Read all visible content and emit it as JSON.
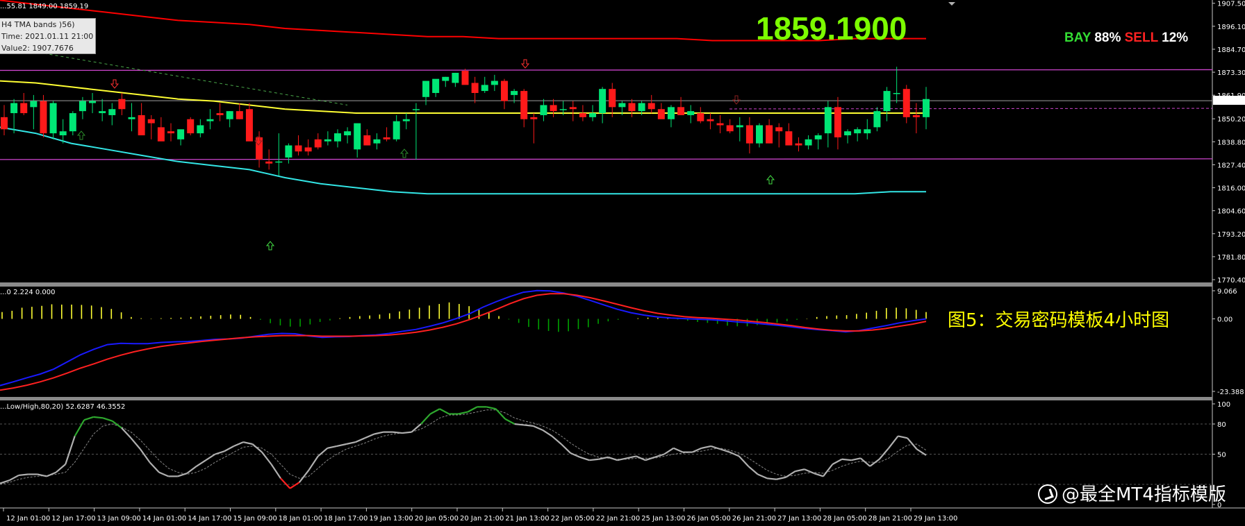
{
  "header": {
    "pane_title": "...55.81 1849.00 1859.19",
    "tooltip": {
      "line1": "H4 TMA bands )56)",
      "line2": "Time: 2021.01.11 21:00",
      "line3": "Value2: 1907.7676"
    },
    "big_price": "1859.1900",
    "sentiment": {
      "bay_label": "BAY",
      "bay_pct": "88%",
      "sell_label": "SELL",
      "sell_pct": "12%"
    }
  },
  "caption": "图5：交易密码模板4小时图",
  "watermark": "@最全MT4指标模版",
  "colors": {
    "bull": "#00e676",
    "bear": "#ff1a1a",
    "upper_band": "#ff0000",
    "mid_band": "#ffff33",
    "lower_band": "#33e6e6",
    "magenta": "#cc44cc",
    "macd_fast": "#1a1aff",
    "macd_slow": "#ff2020",
    "hist_pos": "#ffff33",
    "hist_neg": "#00a000",
    "stoch_main": "#b0b0b0",
    "stoch_ob": "#2ea82e",
    "stoch_os": "#ff2020"
  },
  "chart_data": [
    {
      "type": "candlestick",
      "title": "",
      "ylim": [
        1770.4,
        1907.75
      ],
      "y_ticks": [
        "1907.50",
        "1896.10",
        "1884.70",
        "1873.30",
        "1861.90",
        "1850.20",
        "1838.80",
        "1827.40",
        "1816.00",
        "1804.60",
        "1793.20",
        "1781.80",
        "1770.40"
      ],
      "current_price": "1859.19",
      "x_labels": [
        "12 Jan 01:00",
        "12 Jan 17:00",
        "13 Jan 09:00",
        "14 Jan 01:00",
        "14 Jan 17:00",
        "15 Jan 09:00",
        "18 Jan 01:00",
        "18 Jan 17:00",
        "19 Jan 13:00",
        "20 Jan 05:00",
        "20 Jan 21:00",
        "21 Jan 13:00",
        "22 Jan 05:00",
        "22 Jan 21:00",
        "25 Jan 13:00",
        "26 Jan 05:00",
        "26 Jan 21:00",
        "27 Jan 13:00",
        "28 Jan 05:00",
        "28 Jan 21:00",
        "29 Jan 13:00"
      ],
      "ohlc": [
        [
          1851,
          1857,
          1842,
          1845
        ],
        [
          1853,
          1860,
          1843,
          1858
        ],
        [
          1858,
          1863,
          1852,
          1853
        ],
        [
          1856,
          1862,
          1845,
          1859
        ],
        [
          1859,
          1862,
          1841,
          1843
        ],
        [
          1843,
          1859,
          1840,
          1858
        ],
        [
          1842,
          1850,
          1838,
          1844
        ],
        [
          1844,
          1854,
          1842,
          1853
        ],
        [
          1854,
          1861,
          1850,
          1859
        ],
        [
          1858,
          1863,
          1853,
          1859
        ],
        [
          1853,
          1860,
          1849,
          1854
        ],
        [
          1852,
          1858,
          1847,
          1855
        ],
        [
          1860,
          1863,
          1852,
          1855
        ],
        [
          1850,
          1858,
          1844,
          1851
        ],
        [
          1852,
          1858,
          1844,
          1842
        ],
        [
          1850,
          1852,
          1840,
          1848
        ],
        [
          1846,
          1851,
          1843,
          1839
        ],
        [
          1844,
          1848,
          1839,
          1843
        ],
        [
          1840,
          1843,
          1837,
          1845
        ],
        [
          1850,
          1851,
          1842,
          1843
        ],
        [
          1843,
          1850,
          1841,
          1847
        ],
        [
          1849,
          1855,
          1845,
          1850
        ],
        [
          1853,
          1858,
          1849,
          1852
        ],
        [
          1850,
          1854,
          1846,
          1854
        ],
        [
          1854,
          1858,
          1850,
          1850
        ],
        [
          1855,
          1858,
          1842,
          1839
        ],
        [
          1841,
          1844,
          1826,
          1830
        ],
        [
          1829,
          1835,
          1825,
          1828
        ],
        [
          1829,
          1843,
          1822,
          1829
        ],
        [
          1831,
          1838,
          1828,
          1837
        ],
        [
          1837,
          1842,
          1832,
          1834
        ],
        [
          1836,
          1840,
          1832,
          1834
        ],
        [
          1840,
          1843,
          1835,
          1836
        ],
        [
          1839,
          1844,
          1837,
          1840
        ],
        [
          1839,
          1845,
          1836,
          1843
        ],
        [
          1842,
          1846,
          1838,
          1844
        ],
        [
          1835,
          1842,
          1831,
          1848
        ],
        [
          1842,
          1845,
          1837,
          1837
        ],
        [
          1838,
          1843,
          1835,
          1840
        ],
        [
          1841,
          1846,
          1839,
          1840
        ],
        [
          1840,
          1852,
          1839,
          1849
        ],
        [
          1849,
          1853,
          1845,
          1850
        ],
        [
          1855,
          1858,
          1830,
          1855
        ],
        [
          1861,
          1862,
          1857,
          1869
        ],
        [
          1863,
          1869,
          1861,
          1870
        ],
        [
          1869,
          1871,
          1866,
          1871
        ],
        [
          1868,
          1873,
          1866,
          1873
        ],
        [
          1874,
          1875,
          1868,
          1867
        ],
        [
          1868,
          1871,
          1858,
          1863
        ],
        [
          1864,
          1871,
          1863,
          1867
        ],
        [
          1867,
          1872,
          1864,
          1869
        ],
        [
          1869,
          1870,
          1855,
          1859
        ],
        [
          1862,
          1865,
          1858,
          1864
        ],
        [
          1864,
          1865,
          1846,
          1850
        ],
        [
          1851,
          1853,
          1838,
          1850
        ],
        [
          1852,
          1860,
          1849,
          1857
        ],
        [
          1857,
          1860,
          1851,
          1854
        ],
        [
          1855,
          1859,
          1852,
          1855
        ],
        [
          1856,
          1859,
          1849,
          1855
        ],
        [
          1853,
          1857,
          1849,
          1851
        ],
        [
          1851,
          1857,
          1849,
          1853
        ],
        [
          1853,
          1866,
          1848,
          1865
        ],
        [
          1865,
          1868,
          1851,
          1856
        ],
        [
          1856,
          1859,
          1852,
          1858
        ],
        [
          1858,
          1860,
          1851,
          1854
        ],
        [
          1854,
          1859,
          1852,
          1858
        ],
        [
          1858,
          1862,
          1853,
          1855
        ],
        [
          1855,
          1858,
          1851,
          1850
        ],
        [
          1850,
          1857,
          1846,
          1856
        ],
        [
          1856,
          1861,
          1852,
          1852
        ],
        [
          1852,
          1857,
          1848,
          1854
        ],
        [
          1853,
          1856,
          1848,
          1849
        ],
        [
          1850,
          1853,
          1845,
          1849
        ],
        [
          1848,
          1852,
          1843,
          1847
        ],
        [
          1847,
          1850,
          1843,
          1844
        ],
        [
          1846,
          1851,
          1839,
          1847
        ],
        [
          1847,
          1851,
          1833,
          1838
        ],
        [
          1838,
          1848,
          1836,
          1847
        ],
        [
          1847,
          1850,
          1838,
          1838
        ],
        [
          1846,
          1848,
          1836,
          1844
        ],
        [
          1844,
          1848,
          1838,
          1837
        ],
        [
          1838,
          1841,
          1834,
          1837
        ],
        [
          1837,
          1842,
          1835,
          1840
        ],
        [
          1840,
          1843,
          1835,
          1842
        ],
        [
          1843,
          1859,
          1836,
          1856
        ],
        [
          1856,
          1861,
          1835,
          1841
        ],
        [
          1842,
          1845,
          1838,
          1844
        ],
        [
          1843,
          1846,
          1839,
          1845
        ],
        [
          1843,
          1850,
          1840,
          1845
        ],
        [
          1846,
          1856,
          1844,
          1854
        ],
        [
          1854,
          1866,
          1849,
          1864
        ],
        [
          1863,
          1876,
          1858,
          1863
        ],
        [
          1865,
          1867,
          1848,
          1851
        ],
        [
          1852,
          1858,
          1843,
          1851
        ],
        [
          1851,
          1866,
          1845,
          1860
        ]
      ],
      "upper_band": [
        1909,
        1907,
        1905,
        1903,
        1901,
        1899,
        1898,
        1897,
        1895,
        1894,
        1893,
        1892,
        1891,
        1891,
        1890,
        1890,
        1890,
        1890,
        1890,
        1890,
        1889,
        1889,
        1889,
        1889,
        1890,
        1890,
        1890
      ],
      "mid_band": [
        1869,
        1868,
        1866,
        1864,
        1862,
        1860,
        1859,
        1857,
        1855,
        1854,
        1853,
        1853,
        1853,
        1853,
        1853,
        1853,
        1853,
        1853,
        1853,
        1853,
        1853,
        1853,
        1853,
        1853,
        1853,
        1853,
        1853
      ],
      "lower_band": [
        1846,
        1843,
        1838,
        1835,
        1832,
        1829,
        1827,
        1825,
        1821,
        1818,
        1816,
        1814,
        1813,
        1813,
        1813,
        1813,
        1813,
        1813,
        1813,
        1813,
        1813,
        1813,
        1813,
        1813,
        1813,
        1814,
        1814
      ],
      "magenta_upper": 1874.2,
      "magenta_lower": 1830.0
    },
    {
      "type": "line",
      "title": "",
      "header_text": "...0 2.224 0.000",
      "ylim": [
        -23.388,
        9.066
      ],
      "y_ticks": [
        "9.066",
        "0.00",
        "-23.388"
      ],
      "histogram": [
        2.2,
        2.6,
        3.6,
        3.9,
        4.2,
        4.7,
        4.6,
        4.6,
        4.5,
        4.3,
        3.8,
        3.2,
        2.1,
        0.6,
        0.2,
        0.1,
        0.2,
        0.3,
        0.4,
        0.6,
        0.8,
        1.0,
        1.2,
        1.4,
        1.3,
        0.6,
        -0.3,
        -1.4,
        -2.1,
        -2.5,
        -2.5,
        -1.8,
        -1.0,
        -0.5,
        0.2,
        0.6,
        0.9,
        1.1,
        1.4,
        1.8,
        2.4,
        3.0,
        3.6,
        4.3,
        4.8,
        5.3,
        4.8,
        4.1,
        3.2,
        2.1,
        0.9,
        -0.2,
        -1.3,
        -2.6,
        -3.4,
        -3.9,
        -4.2,
        -4.0,
        -3.3,
        -2.7,
        -1.6,
        -0.8,
        -0.3,
        0.0,
        0.2,
        0.4,
        0.3,
        0.2,
        -0.2,
        -0.6,
        -1.0,
        -1.3,
        -1.6,
        -2.2,
        -2.4,
        -2.4,
        -2.0,
        -1.6,
        -1.2,
        -0.7,
        -0.3,
        0.1,
        0.6,
        0.9,
        1.1,
        1.2,
        1.6,
        2.0,
        2.6,
        3.5,
        3.6,
        3.4,
        2.9,
        2.2
      ],
      "fast": [
        -21.5,
        -20.3,
        -19.0,
        -17.8,
        -16.2,
        -13.9,
        -11.6,
        -9.8,
        -8.3,
        -7.9,
        -8.0,
        -8.0,
        -7.6,
        -7.4,
        -7.3,
        -7.0,
        -6.6,
        -6.5,
        -6.2,
        -5.6,
        -5.0,
        -4.7,
        -4.8,
        -5.5,
        -6.0,
        -5.8,
        -5.7,
        -5.4,
        -5.2,
        -4.7,
        -4.0,
        -3.4,
        -2.4,
        -1.3,
        0.1,
        1.7,
        3.8,
        5.6,
        7.2,
        8.6,
        9.1,
        9.0,
        8.3,
        7.3,
        5.9,
        4.5,
        3.1,
        2.0,
        1.2,
        0.6,
        0.3,
        0.1,
        -0.1,
        -0.3,
        -0.6,
        -1.0,
        -1.3,
        -1.7,
        -2.1,
        -2.6,
        -3.1,
        -3.5,
        -3.8,
        -4.2,
        -3.8,
        -3.0,
        -2.2,
        -1.3,
        -0.6,
        0.0
      ],
      "slow": [
        -23.0,
        -22.3,
        -21.4,
        -20.3,
        -19.0,
        -17.5,
        -15.9,
        -14.5,
        -13.0,
        -11.7,
        -10.6,
        -9.7,
        -8.9,
        -8.3,
        -7.8,
        -7.3,
        -6.9,
        -6.5,
        -6.1,
        -5.8,
        -5.6,
        -5.4,
        -5.4,
        -5.4,
        -5.6,
        -5.6,
        -5.6,
        -5.5,
        -5.4,
        -5.2,
        -4.8,
        -4.3,
        -3.6,
        -2.7,
        -1.6,
        -0.2,
        1.4,
        3.1,
        4.9,
        6.5,
        7.6,
        8.1,
        8.1,
        7.6,
        6.8,
        5.8,
        4.7,
        3.6,
        2.6,
        1.8,
        1.2,
        0.7,
        0.4,
        0.2,
        -0.1,
        -0.4,
        -0.8,
        -1.2,
        -1.7,
        -2.2,
        -2.8,
        -3.3,
        -3.7,
        -3.9,
        -3.9,
        -3.6,
        -3.1,
        -2.4,
        -1.7,
        -0.8
      ]
    },
    {
      "type": "line",
      "title": "",
      "header_text": "...Low/High,80,20) 52.6287 46.3552",
      "ylim": [
        0,
        100
      ],
      "y_ticks": [
        "100",
        "80",
        "50",
        "0"
      ],
      "main": [
        21,
        24,
        29,
        30,
        30,
        28,
        32,
        40,
        68,
        84,
        87,
        86,
        83,
        76,
        66,
        55,
        42,
        32,
        28,
        28,
        31,
        38,
        44,
        50,
        53,
        58,
        62,
        60,
        52,
        40,
        26,
        16,
        22,
        34,
        48,
        56,
        58,
        60,
        62,
        66,
        70,
        72,
        72,
        71,
        72,
        80,
        90,
        95,
        90,
        90,
        92,
        97,
        97,
        95,
        85,
        80,
        79,
        78,
        74,
        68,
        60,
        51,
        47,
        44,
        45,
        47,
        44,
        46,
        48,
        44,
        47,
        50,
        56,
        52,
        52,
        56,
        58,
        55,
        52,
        48,
        38,
        30,
        26,
        25,
        27,
        33,
        35,
        31,
        28,
        40,
        45,
        44,
        46,
        38,
        45,
        56,
        68,
        66,
        55,
        49
      ],
      "signal": [
        20,
        22,
        25,
        27,
        28,
        29,
        30,
        32,
        42,
        56,
        70,
        78,
        80,
        77,
        72,
        64,
        54,
        44,
        36,
        32,
        30,
        32,
        36,
        42,
        47,
        52,
        57,
        58,
        56,
        50,
        40,
        30,
        26,
        28,
        36,
        44,
        50,
        55,
        58,
        61,
        65,
        68,
        70,
        71,
        72,
        75,
        80,
        86,
        89,
        89,
        90,
        92,
        94,
        94,
        91,
        86,
        83,
        81,
        78,
        74,
        68,
        61,
        55,
        50,
        47,
        46,
        45,
        45,
        46,
        46,
        46,
        48,
        50,
        51,
        52,
        53,
        55,
        56,
        54,
        51,
        46,
        40,
        34,
        30,
        28,
        29,
        31,
        32,
        31,
        34,
        38,
        41,
        43,
        42,
        42,
        46,
        53,
        59,
        60,
        54
      ]
    }
  ]
}
